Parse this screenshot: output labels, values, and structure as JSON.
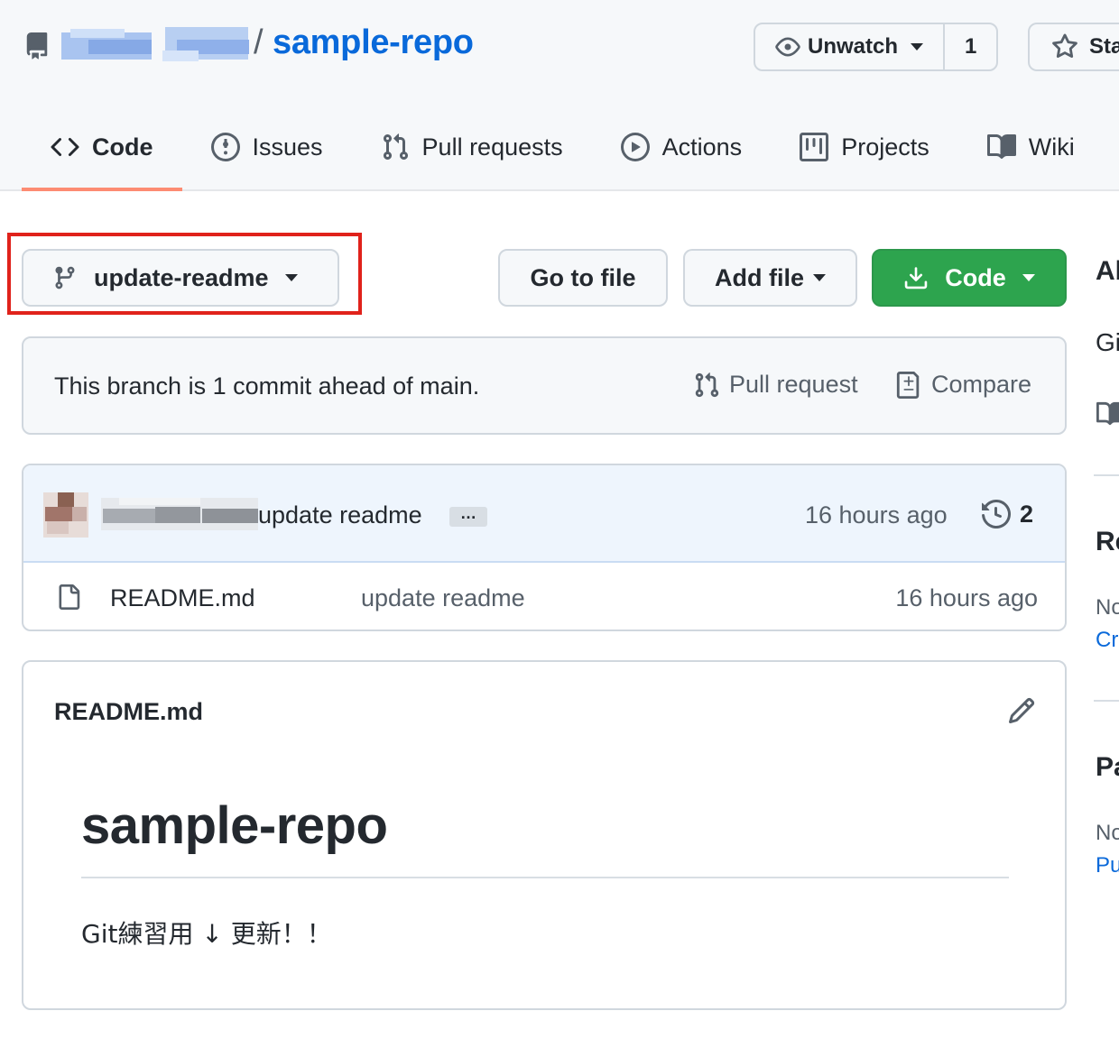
{
  "repo": {
    "name": "sample-repo",
    "separator": "/"
  },
  "header_actions": {
    "watch_label": "Unwatch",
    "watch_count": "1",
    "star_label": "Star"
  },
  "tabs": [
    {
      "label": "Code",
      "icon": "code-icon",
      "active": true
    },
    {
      "label": "Issues",
      "icon": "issue-icon"
    },
    {
      "label": "Pull requests",
      "icon": "pull-request-icon"
    },
    {
      "label": "Actions",
      "icon": "play-icon"
    },
    {
      "label": "Projects",
      "icon": "project-icon"
    },
    {
      "label": "Wiki",
      "icon": "book-icon"
    }
  ],
  "toolbar": {
    "branch": "update-readme",
    "go_to_file": "Go to file",
    "add_file": "Add file",
    "code": "Code"
  },
  "branch_status": {
    "message": "This branch is 1 commit ahead of main.",
    "pull_request": "Pull request",
    "compare": "Compare"
  },
  "latest_commit": {
    "message": "update readme",
    "ellipsis": "…",
    "time": "16 hours ago",
    "commit_count": "2"
  },
  "files": [
    {
      "name": "README.md",
      "commit": "update readme",
      "time": "16 hours ago"
    }
  ],
  "readme": {
    "filename": "README.md",
    "heading": "sample-repo",
    "body": "Git練習用 ↓ 更新！！"
  },
  "sidebar": {
    "about_heading": "About",
    "about_text": "Git",
    "releases_heading": "Releases",
    "releases_text": "No",
    "releases_link": "Create",
    "packages_heading": "Packages",
    "packages_text": "No",
    "packages_link": "Publish"
  },
  "colors": {
    "link": "#0969da",
    "primary_button": "#2da44e",
    "active_tab_underline": "#fd8c73",
    "highlight_box": "#e0221b"
  }
}
